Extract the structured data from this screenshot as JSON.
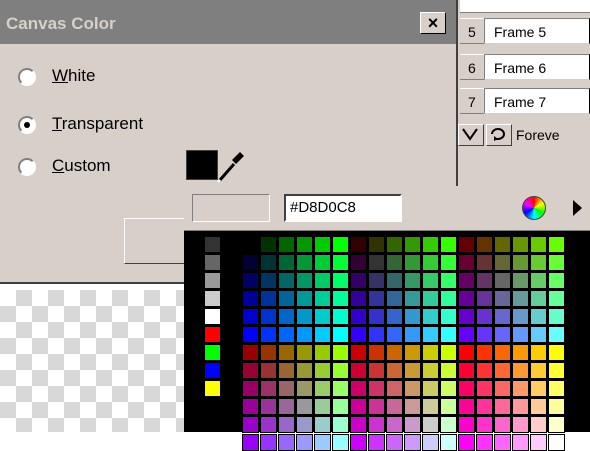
{
  "dialog": {
    "title": "Canvas Color",
    "close_label": "×",
    "options": [
      {
        "label": "White",
        "mnemonic": "W",
        "rest": "hite",
        "checked": false
      },
      {
        "label": "Transparent",
        "mnemonic": "T",
        "rest": "ransparent",
        "checked": true
      },
      {
        "label": "Custom",
        "mnemonic": "C",
        "rest": "ustom",
        "checked": false
      }
    ]
  },
  "picker": {
    "hex_value": "#D8D0C8",
    "preview_color": "#D8D0C8"
  },
  "frames": [
    {
      "num": "5",
      "name": "Frame 5"
    },
    {
      "num": "6",
      "name": "Frame 6"
    },
    {
      "num": "7",
      "name": "Frame 7"
    }
  ],
  "loop": {
    "label": "Foreve"
  },
  "colors": {
    "dialog_bg": "#D8D0C8",
    "titlebar": "#7F7F7F",
    "selected_swatch": "#000000"
  }
}
